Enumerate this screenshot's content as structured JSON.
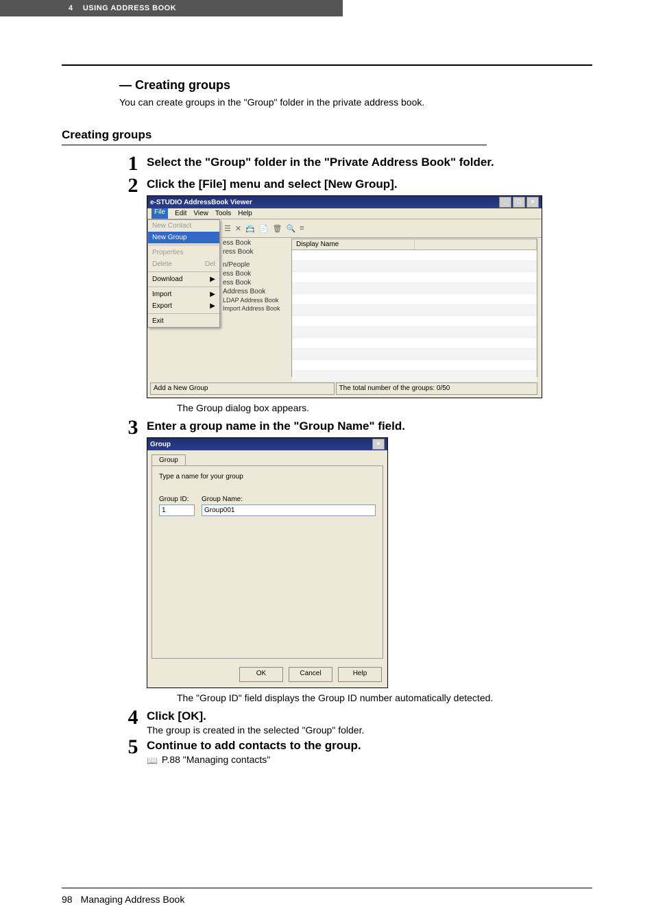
{
  "header": {
    "chapter": "4",
    "title": "USING ADDRESS BOOK"
  },
  "section": {
    "title": "— Creating groups",
    "desc": "You can create groups in the \"Group\" folder in the private address book."
  },
  "subheading": "Creating groups",
  "steps": {
    "s1": {
      "num": "1",
      "title": "Select the \"Group\" folder in the \"Private Address Book\" folder."
    },
    "s2": {
      "num": "2",
      "title": "Click the [File] menu and select [New Group].",
      "caption": "The Group dialog box appears."
    },
    "s3": {
      "num": "3",
      "title": "Enter a group name in the \"Group Name\" field.",
      "caption": "The \"Group ID\" field displays the Group ID number automatically detected."
    },
    "s4": {
      "num": "4",
      "title": "Click [OK].",
      "text": "The group is created in the selected \"Group\" folder."
    },
    "s5": {
      "num": "5",
      "title": "Continue to add contacts to the group.",
      "ref": "P.88 \"Managing contacts\""
    }
  },
  "app_window": {
    "title": "e-STUDIO AddressBook Viewer",
    "menubar": [
      "File",
      "Edit",
      "View",
      "Tools",
      "Help"
    ],
    "file_menu": {
      "new_contact": "New Contact",
      "new_group": "New Group",
      "properties": "Properties",
      "delete": "Delete",
      "delete_key": "Del",
      "download": "Download",
      "import": "Import",
      "export": "Export",
      "exit": "Exit"
    },
    "tree": {
      "ess_book": "ess Book",
      "ress_book": "ress Book",
      "n_people": "n/People",
      "ess_book2": "ess Book",
      "ess_book3": "ess Book",
      "address_book": "Address Book",
      "ldap_ab": "LDAP Address Book",
      "import_ab": "Import Address Book"
    },
    "list_header": {
      "col1": "Display Name",
      "col2": ""
    },
    "status": {
      "left": "Add a New Group",
      "right": "The total number of the groups: 0/50"
    }
  },
  "dialog": {
    "title": "Group",
    "tab": "Group",
    "instruction": "Type a name for your group",
    "id_label": "Group ID:",
    "id_value": "1",
    "name_label": "Group Name:",
    "name_value": "Group001",
    "buttons": {
      "ok": "OK",
      "cancel": "Cancel",
      "help": "Help"
    }
  },
  "footer": {
    "page": "98",
    "title": "Managing Address Book"
  }
}
